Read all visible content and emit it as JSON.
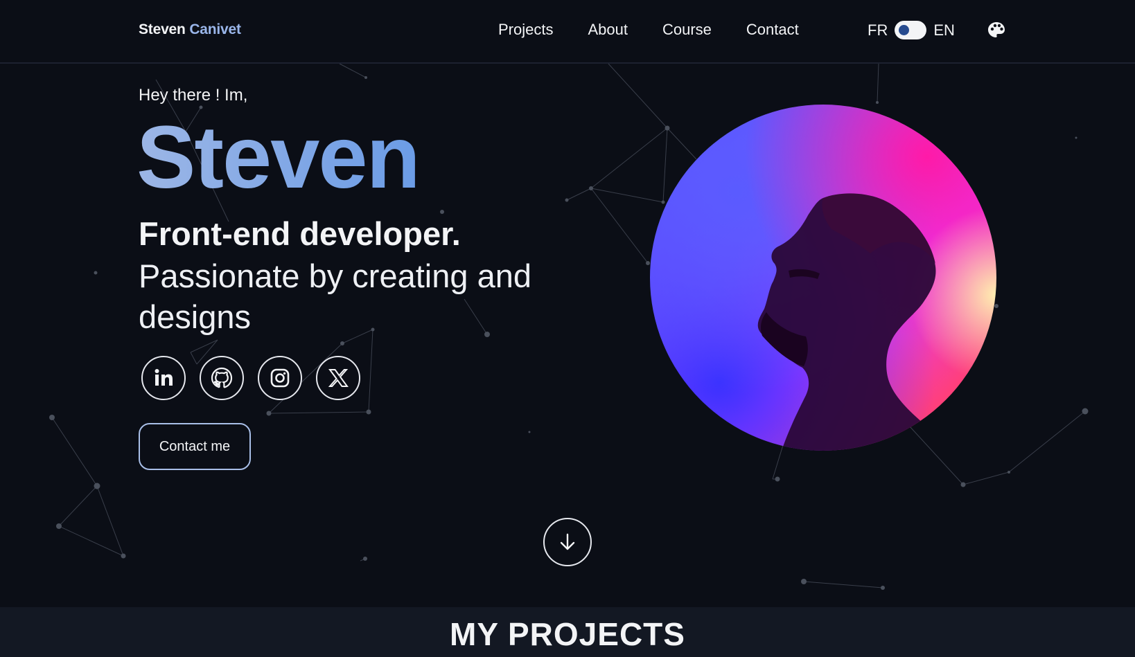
{
  "header": {
    "logo_first": "Steven",
    "logo_last": "Canivet",
    "nav": [
      "Projects",
      "About",
      "Course",
      "Contact"
    ],
    "lang_left": "FR",
    "lang_right": "EN"
  },
  "hero": {
    "greeting": "Hey there ! Im,",
    "name": "Steven",
    "role": "Front-end developer.",
    "tagline": "Passionate by creating and designs",
    "socials": [
      "linkedin-icon",
      "github-icon",
      "instagram-icon",
      "x-icon"
    ],
    "contact_label": "Contact me"
  },
  "projects": {
    "title": "MY PROJECTS"
  },
  "colors": {
    "background": "#0b0e16",
    "accent": "#9ab6ea",
    "band": "#131823"
  }
}
